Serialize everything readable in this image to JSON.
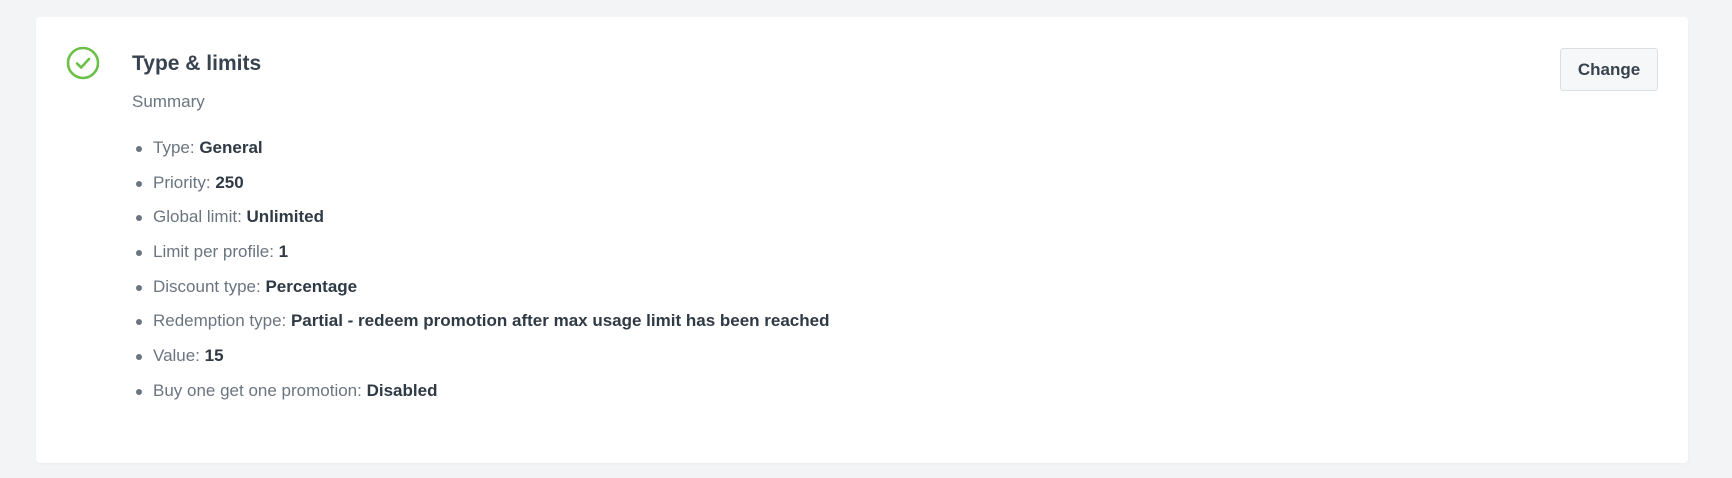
{
  "section": {
    "title": "Type & limits",
    "subtitle": "Summary",
    "status_icon": "check-circle-icon",
    "status_color": "#6cc04a",
    "change_label": "Change"
  },
  "summary": {
    "items": [
      {
        "label": "Type: ",
        "value": "General"
      },
      {
        "label": "Priority: ",
        "value": "250"
      },
      {
        "label": "Global limit: ",
        "value": "Unlimited"
      },
      {
        "label": "Limit per profile: ",
        "value": "1"
      },
      {
        "label": "Discount type: ",
        "value": "Percentage"
      },
      {
        "label": "Redemption type: ",
        "value": "Partial - redeem promotion after max usage limit has been reached"
      },
      {
        "label": "Value: ",
        "value": "15"
      },
      {
        "label": "Buy one get one promotion: ",
        "value": "Disabled"
      }
    ]
  }
}
